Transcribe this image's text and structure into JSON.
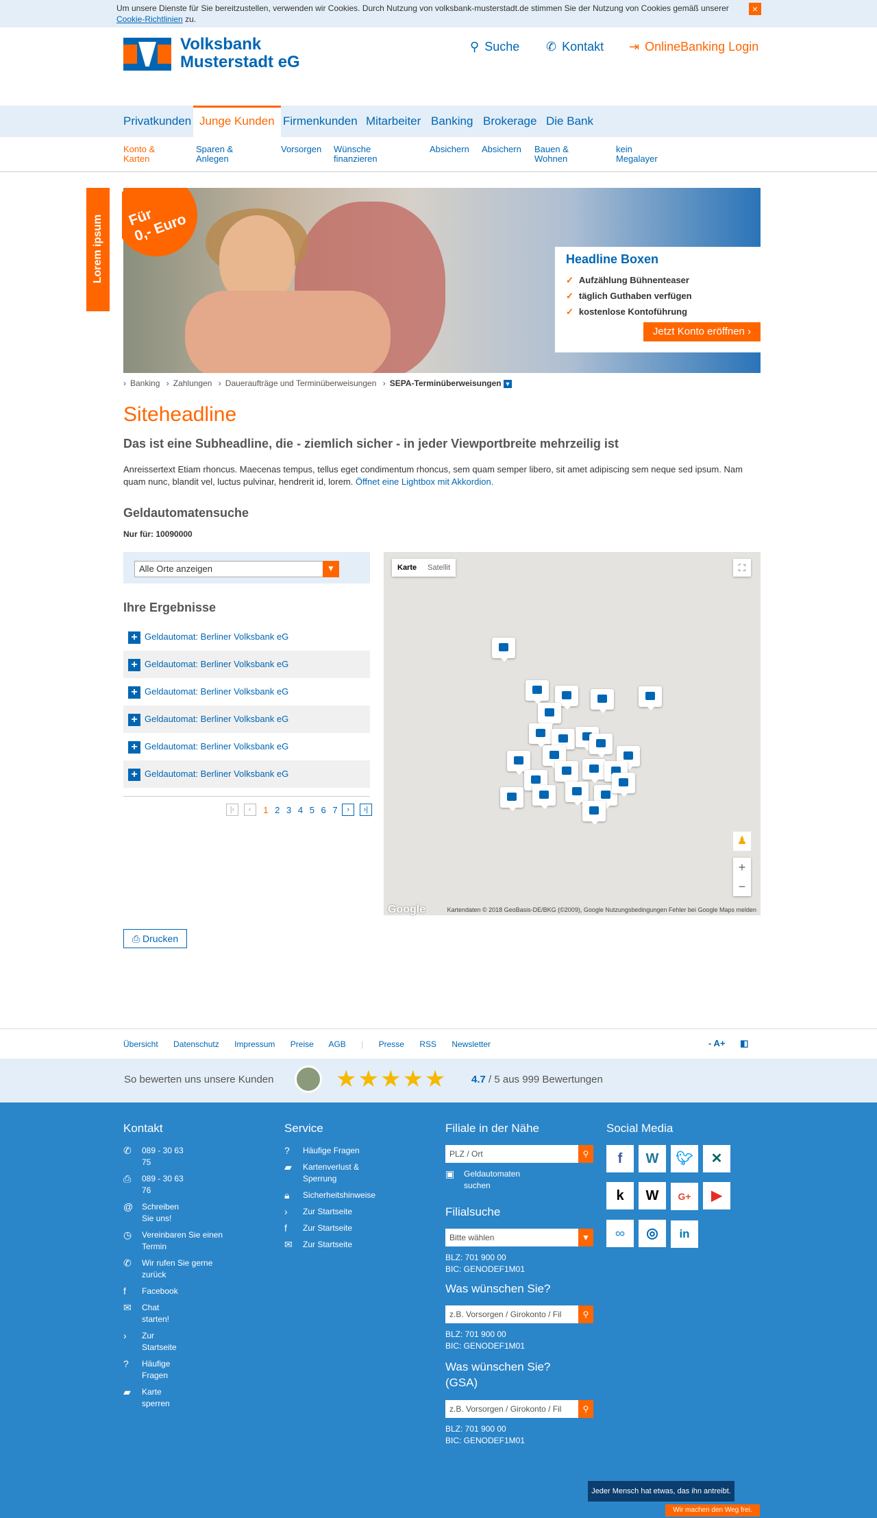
{
  "cookie": {
    "text": "Um unsere Dienste für Sie bereitzustellen, verwenden wir Cookies. Durch Nutzung von volksbank-musterstadt.de stimmen Sie der Nutzung von Cookies gemäß unserer",
    "link": "Cookie-Richtlinien",
    "suffix": "zu.",
    "close": "×"
  },
  "header": {
    "brand_line1": "Volksbank",
    "brand_line2": "Musterstadt eG",
    "search": "Suche",
    "contact": "Kontakt",
    "login": "OnlineBanking Login"
  },
  "mainnav": [
    "Privatkunden",
    "Junge Kunden",
    "Firmenkunden",
    "Mitarbeiter",
    "Banking",
    "Brokerage",
    "Die Bank"
  ],
  "subnav": [
    {
      "l1": "Konto &",
      "l2": "Karten"
    },
    {
      "l1": "Sparen &",
      "l2": "Anlegen"
    },
    {
      "l1": "Vorsorgen",
      "l2": ""
    },
    {
      "l1": "Wünsche",
      "l2": "finanzieren"
    },
    {
      "l1": "Absichern",
      "l2": ""
    },
    {
      "l1": "Absichern",
      "l2": ""
    },
    {
      "l1": "Bauen &",
      "l2": "Wohnen"
    },
    {
      "l1": "kein",
      "l2": "Megalayer"
    }
  ],
  "hero": {
    "sidetab": "Lorem ipsum",
    "badge_l1": "Für",
    "badge_l2": "0,- Euro",
    "teaser_title": "Headline Boxen",
    "teaser_items": [
      "Aufzählung Bühnenteaser",
      "täglich Guthaben verfügen",
      "kostenlose Kontoführung"
    ],
    "cta": "Jetzt Konto eröffnen ›"
  },
  "breadcrumb": [
    "Banking",
    "Zahlungen",
    "Daueraufträge und Terminüberweisungen",
    "SEPA-Terminüberweisungen"
  ],
  "content": {
    "headline": "Siteheadline",
    "subheadline": "Das ist eine Subheadline, die - ziemlich sicher - in jeder Viewportbreite mehrzeilig ist",
    "intro": "Anreissertext Etiam rhoncus. Maecenas tempus, tellus eget condimentum rhoncus, sem quam semper libero, sit amet adipiscing sem neque sed ipsum. Nam quam nunc, blandit vel, luctus pulvinar, hendrerit id, lorem.",
    "intro_link": "Öffnet eine Lightbox mit Akkordion.",
    "section": "Geldautomatensuche",
    "nurfuer": "Nur für: 10090000"
  },
  "results": {
    "filter": "Alle Orte anzeigen",
    "title": "Ihre Ergebnisse",
    "items": [
      "Geldautomat: Berliner Volksbank eG",
      "Geldautomat: Berliner Volksbank eG",
      "Geldautomat: Berliner Volksbank eG",
      "Geldautomat: Berliner Volksbank eG",
      "Geldautomat: Berliner Volksbank eG",
      "Geldautomat: Berliner Volksbank eG"
    ],
    "pages": [
      "1",
      "2",
      "3",
      "4",
      "5",
      "6",
      "7"
    ],
    "current_page": "1"
  },
  "map": {
    "tab_map": "Karte",
    "tab_sat": "Satellit",
    "logo": "Google",
    "attribution": "Kartendaten © 2018 GeoBasis-DE/BKG (©2009), Google    Nutzungsbedingungen    Fehler bei Google Maps melden"
  },
  "print": "Drucken",
  "footnav": [
    "Übersicht",
    "Datenschutz",
    "Impressum",
    "Preise",
    "AGB",
    "Presse",
    "RSS",
    "Newsletter"
  ],
  "fontsize": "- A+",
  "rating": {
    "label": "So bewerten uns unsere Kunden",
    "score": "4.7",
    "suffix": "/ 5 aus 999 Bewertungen"
  },
  "footer": {
    "kontakt_title": "Kontakt",
    "kontakt": [
      "089 - 30 63 75",
      "089 - 30 63 76",
      "Schreiben Sie uns!",
      "Vereinbaren Sie einen Termin",
      "Wir rufen Sie gerne zurück",
      "Facebook",
      "Chat starten!",
      "Zur Startseite",
      "Häufige Fragen",
      "Karte sperren"
    ],
    "service_title": "Service",
    "service": [
      "Häufige Fragen",
      "Kartenverlust & Sperrung",
      "Sicherheitshinweise",
      "Zur Startseite",
      "Zur Startseite",
      "Zur Startseite"
    ],
    "filiale_title": "Filiale in der Nähe",
    "plz_placeholder": "PLZ / Ort",
    "geld_link": "Geldautomaten suchen",
    "filialsuche_title": "Filialsuche",
    "filialsuche_select": "Bitte wählen",
    "blz": "BLZ: 701 900 00",
    "bic": "BIC: GENODEF1M01",
    "wunsch_title": "Was wünschen Sie?",
    "wunsch_placeholder": "z.B. Vorsorgen / Girokonto / Fil",
    "wunsch_title2": "Was wünschen Sie? (GSA)",
    "social_title": "Social Media",
    "claim1": "Jeder Mensch hat etwas, das ihn antreibt.",
    "claim2": "Wir machen den Weg frei."
  }
}
